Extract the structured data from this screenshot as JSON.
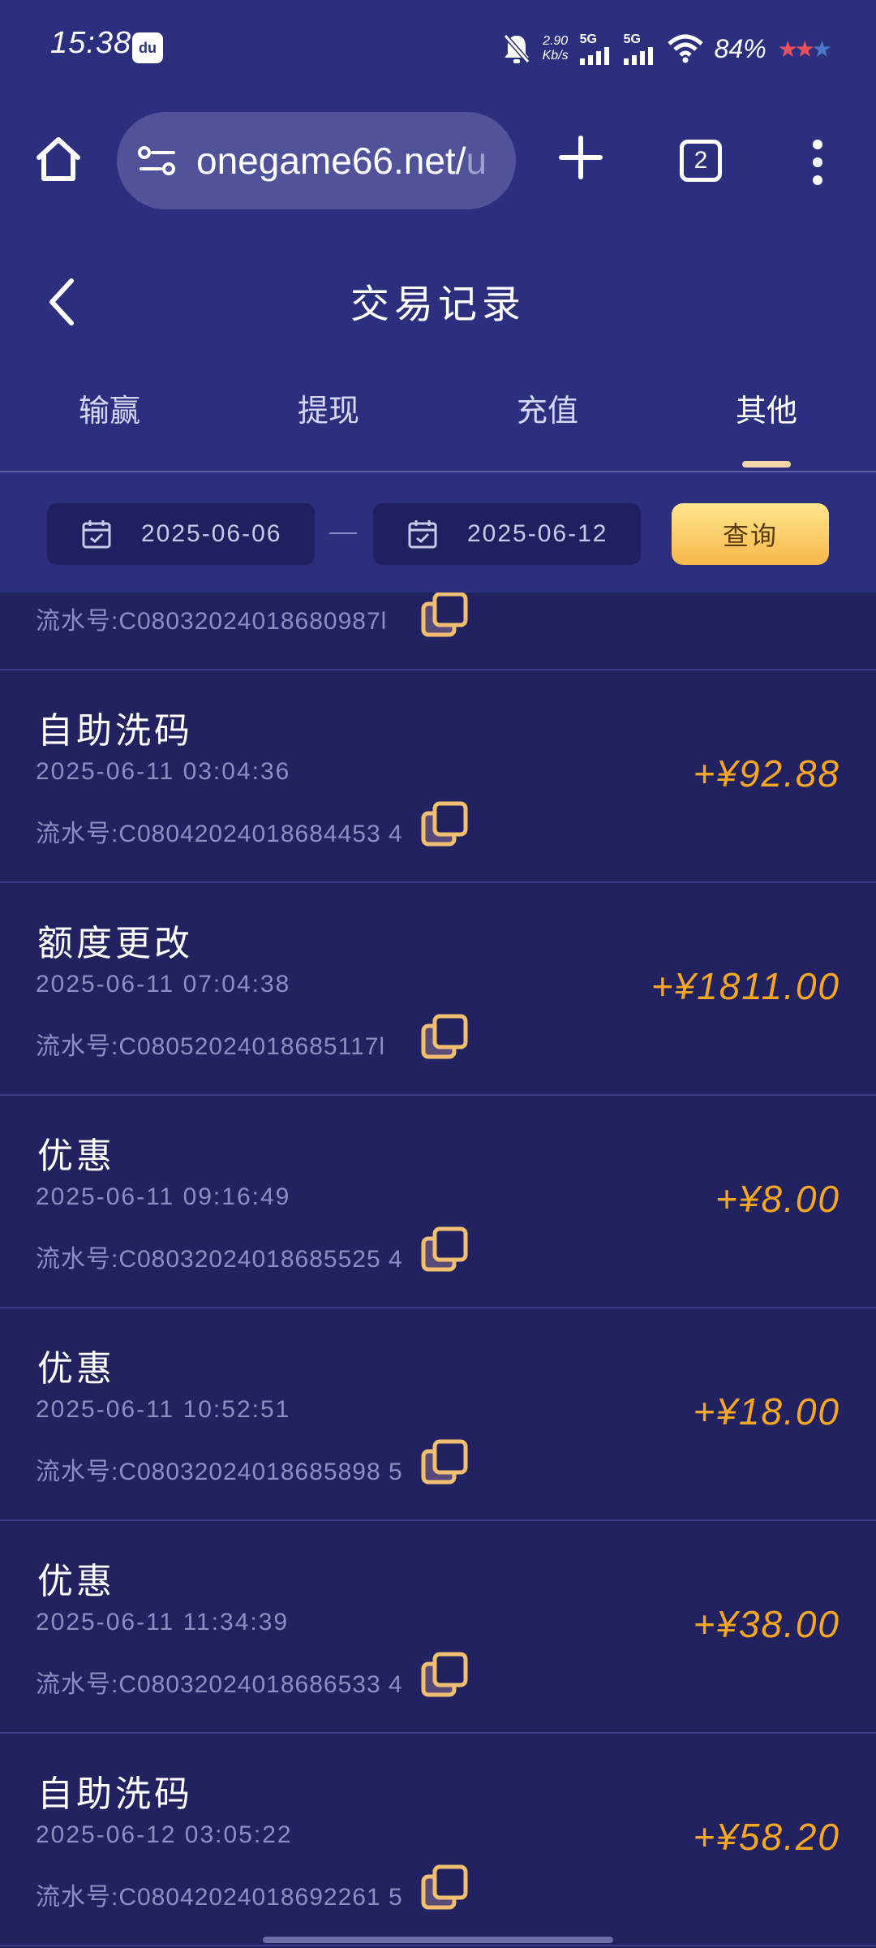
{
  "status_bar": {
    "time": "15:38",
    "app_icon": "du",
    "net_speed_value": "2.90",
    "net_speed_unit": "Kb/s",
    "signal1": "5G",
    "signal2": "5G",
    "battery": "84%",
    "icons": [
      "mute-bell-icon",
      "signal-icon",
      "wifi-icon",
      "rating-stars-icon"
    ]
  },
  "browser": {
    "url_main": "onegame66.net/",
    "url_fade": "u",
    "tab_count": "2"
  },
  "header": {
    "title": "交易记录"
  },
  "tabs": [
    {
      "label": "输赢",
      "active": false
    },
    {
      "label": "提现",
      "active": false
    },
    {
      "label": "充值",
      "active": false
    },
    {
      "label": "其他",
      "active": true
    }
  ],
  "filter": {
    "start_date": "2025-06-06",
    "end_date": "2025-06-12",
    "query_label": "查询"
  },
  "partial_record": {
    "serial": "流水号:C08032024018680987l"
  },
  "records": [
    {
      "title": "自助洗码",
      "time": "2025-06-11 03:04:36",
      "serial": "流水号:C08042024018684453 4",
      "amount": "+¥92.88"
    },
    {
      "title": "额度更改",
      "time": "2025-06-11 07:04:38",
      "serial": "流水号:C08052024018685117l",
      "amount": "+¥1811.00"
    },
    {
      "title": "优惠",
      "time": "2025-06-11 09:16:49",
      "serial": "流水号:C08032024018685525 4",
      "amount": "+¥8.00"
    },
    {
      "title": "优惠",
      "time": "2025-06-11 10:52:51",
      "serial": "流水号:C08032024018685898 5",
      "amount": "+¥18.00"
    },
    {
      "title": "优惠",
      "time": "2025-06-11 11:34:39",
      "serial": "流水号:C08032024018686533 4",
      "amount": "+¥38.00"
    },
    {
      "title": "自助洗码",
      "time": "2025-06-12 03:05:22",
      "serial": "流水号:C08042024018692261 5",
      "amount": "+¥58.20"
    }
  ]
}
